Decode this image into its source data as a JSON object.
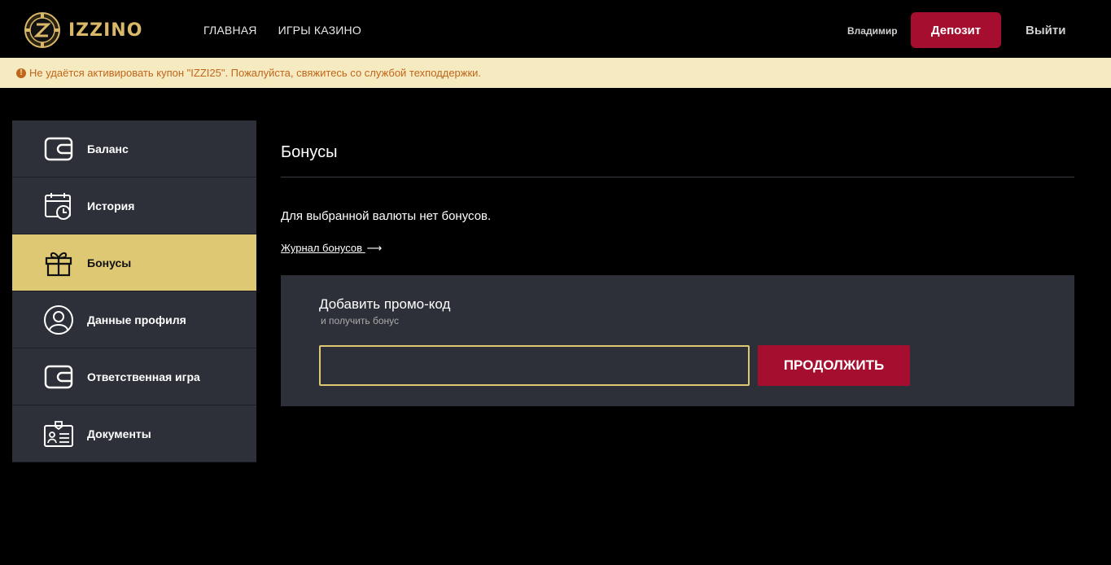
{
  "header": {
    "logo_text": "IZZINO",
    "nav": [
      "ГЛАВНАЯ",
      "ИГРЫ КАЗИНО"
    ],
    "username": "Владимир",
    "deposit_label": "Депозит",
    "logout_label": "Выйти"
  },
  "alert": {
    "icon": "!",
    "text": "Не удаётся активировать купон \"IZZI25\". Пожалуйста, свяжитесь со службой техподдержки."
  },
  "sidebar": {
    "items": [
      {
        "label": "Баланс",
        "icon": "wallet-icon"
      },
      {
        "label": "История",
        "icon": "calendar-clock-icon"
      },
      {
        "label": "Бонусы",
        "icon": "gift-icon",
        "active": true
      },
      {
        "label": "Данные профиля",
        "icon": "user-icon"
      },
      {
        "label": "Ответственная игра",
        "icon": "wallet-icon"
      },
      {
        "label": "Документы",
        "icon": "id-card-icon"
      }
    ]
  },
  "main": {
    "title": "Бонусы",
    "no_bonus_text": "Для выбранной валюты нет бонусов.",
    "journal_link": "Журнал бонусов",
    "journal_arrow": "⟶",
    "promo": {
      "title": "Добавить промо-код",
      "subtitle": "и получить бонус",
      "input_value": "",
      "button_label": "ПРОДОЛЖИТЬ"
    }
  },
  "colors": {
    "accent_red": "#a60e30",
    "accent_gold": "#dec874",
    "panel": "#2d3039",
    "alert_bg": "#f6eac0",
    "alert_text": "#c0661b"
  }
}
